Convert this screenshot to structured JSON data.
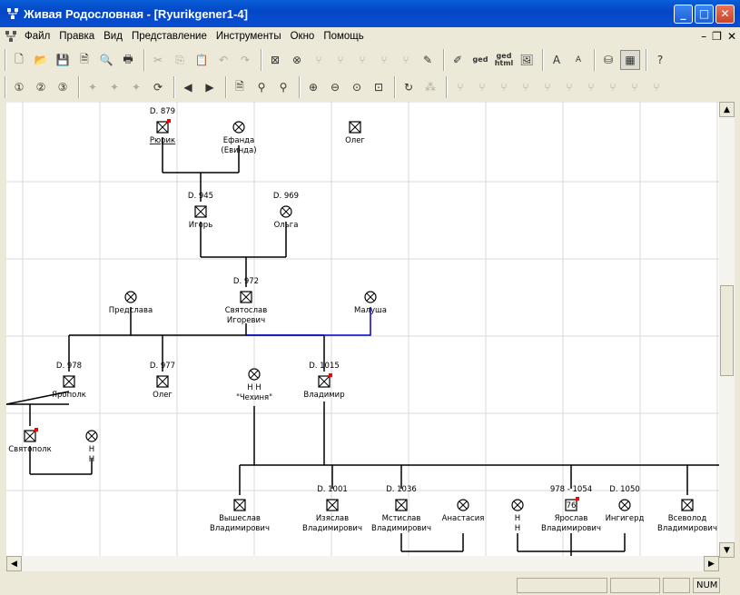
{
  "window": {
    "title": "Живая Родословная - [Ryurikgener1-4]"
  },
  "menu": [
    "Файл",
    "Правка",
    "Вид",
    "Представление",
    "Инструменты",
    "Окно",
    "Помощь"
  ],
  "toolbar_text": {
    "ged": "ged",
    "ged_html": "ged html"
  },
  "tree": {
    "people": [
      {
        "id": "ryurik",
        "name": [
          "Рюрик"
        ],
        "date": "D. 879",
        "sex": "m",
        "link": true,
        "mark": true
      },
      {
        "id": "efanda",
        "name": [
          "Ефанда",
          "(Евинда)"
        ],
        "date": "",
        "sex": "f"
      },
      {
        "id": "oleg1",
        "name": [
          "Олег"
        ],
        "date": "",
        "sex": "m"
      },
      {
        "id": "igor",
        "name": [
          "Игорь"
        ],
        "date": "D. 945",
        "sex": "m"
      },
      {
        "id": "olga",
        "name": [
          "Ольга"
        ],
        "date": "D. 969",
        "sex": "f"
      },
      {
        "id": "predslava",
        "name": [
          "Предслава"
        ],
        "date": "",
        "sex": "f"
      },
      {
        "id": "svyatoslav",
        "name": [
          "Святослав",
          "Игоревич"
        ],
        "date": "D. 972",
        "sex": "m"
      },
      {
        "id": "malusha",
        "name": [
          "Малуша"
        ],
        "date": "",
        "sex": "f"
      },
      {
        "id": "yaropolk",
        "name": [
          "Ярополк"
        ],
        "date": "D. 978",
        "sex": "m"
      },
      {
        "id": "oleg2",
        "name": [
          "Олег"
        ],
        "date": "D. 977",
        "sex": "m"
      },
      {
        "id": "chekhinya",
        "name": [
          "Н Н",
          "\"Чехиня\""
        ],
        "date": "",
        "sex": "f"
      },
      {
        "id": "vladimir",
        "name": [
          "Владимир"
        ],
        "date": "D. 1015",
        "sex": "m",
        "mark": true
      },
      {
        "id": "svyatopolk",
        "name": [
          "Святополк"
        ],
        "date": "",
        "sex": "m",
        "mark": true
      },
      {
        "id": "nn1",
        "name": [
          "Н",
          "Н"
        ],
        "date": "",
        "sex": "f"
      },
      {
        "id": "vysheslav",
        "name": [
          "Вышеслав",
          "Владимирович"
        ],
        "date": "",
        "sex": "m"
      },
      {
        "id": "izyaslav",
        "name": [
          "Изяслав",
          "Владимирович"
        ],
        "date": "D. 1001",
        "sex": "m"
      },
      {
        "id": "mstislav",
        "name": [
          "Мстислав",
          "Владимирович"
        ],
        "date": "D. 1036",
        "sex": "m"
      },
      {
        "id": "anastasia",
        "name": [
          "Анастасия"
        ],
        "date": "",
        "sex": "f"
      },
      {
        "id": "nn2",
        "name": [
          "Н",
          "Н"
        ],
        "date": "",
        "sex": "f"
      },
      {
        "id": "yaroslav",
        "name": [
          "Ярослав",
          "Владимирович"
        ],
        "date": "978 - 1054",
        "sex": "m",
        "mark": true,
        "badge": "76"
      },
      {
        "id": "ingigerd",
        "name": [
          "Ингигерд"
        ],
        "date": "D. 1050",
        "sex": "f"
      },
      {
        "id": "vsevolod",
        "name": [
          "Всеволод",
          "Владимирович"
        ],
        "date": "",
        "sex": "m"
      }
    ]
  },
  "status": {
    "num": "NUM"
  },
  "colors": {
    "titlebar": "#0a5fd8",
    "grid": "#d8d8d8",
    "line": "#000000",
    "highlight_line": "#0000cc",
    "marker": "#ff0000",
    "link": "#0000ff"
  }
}
